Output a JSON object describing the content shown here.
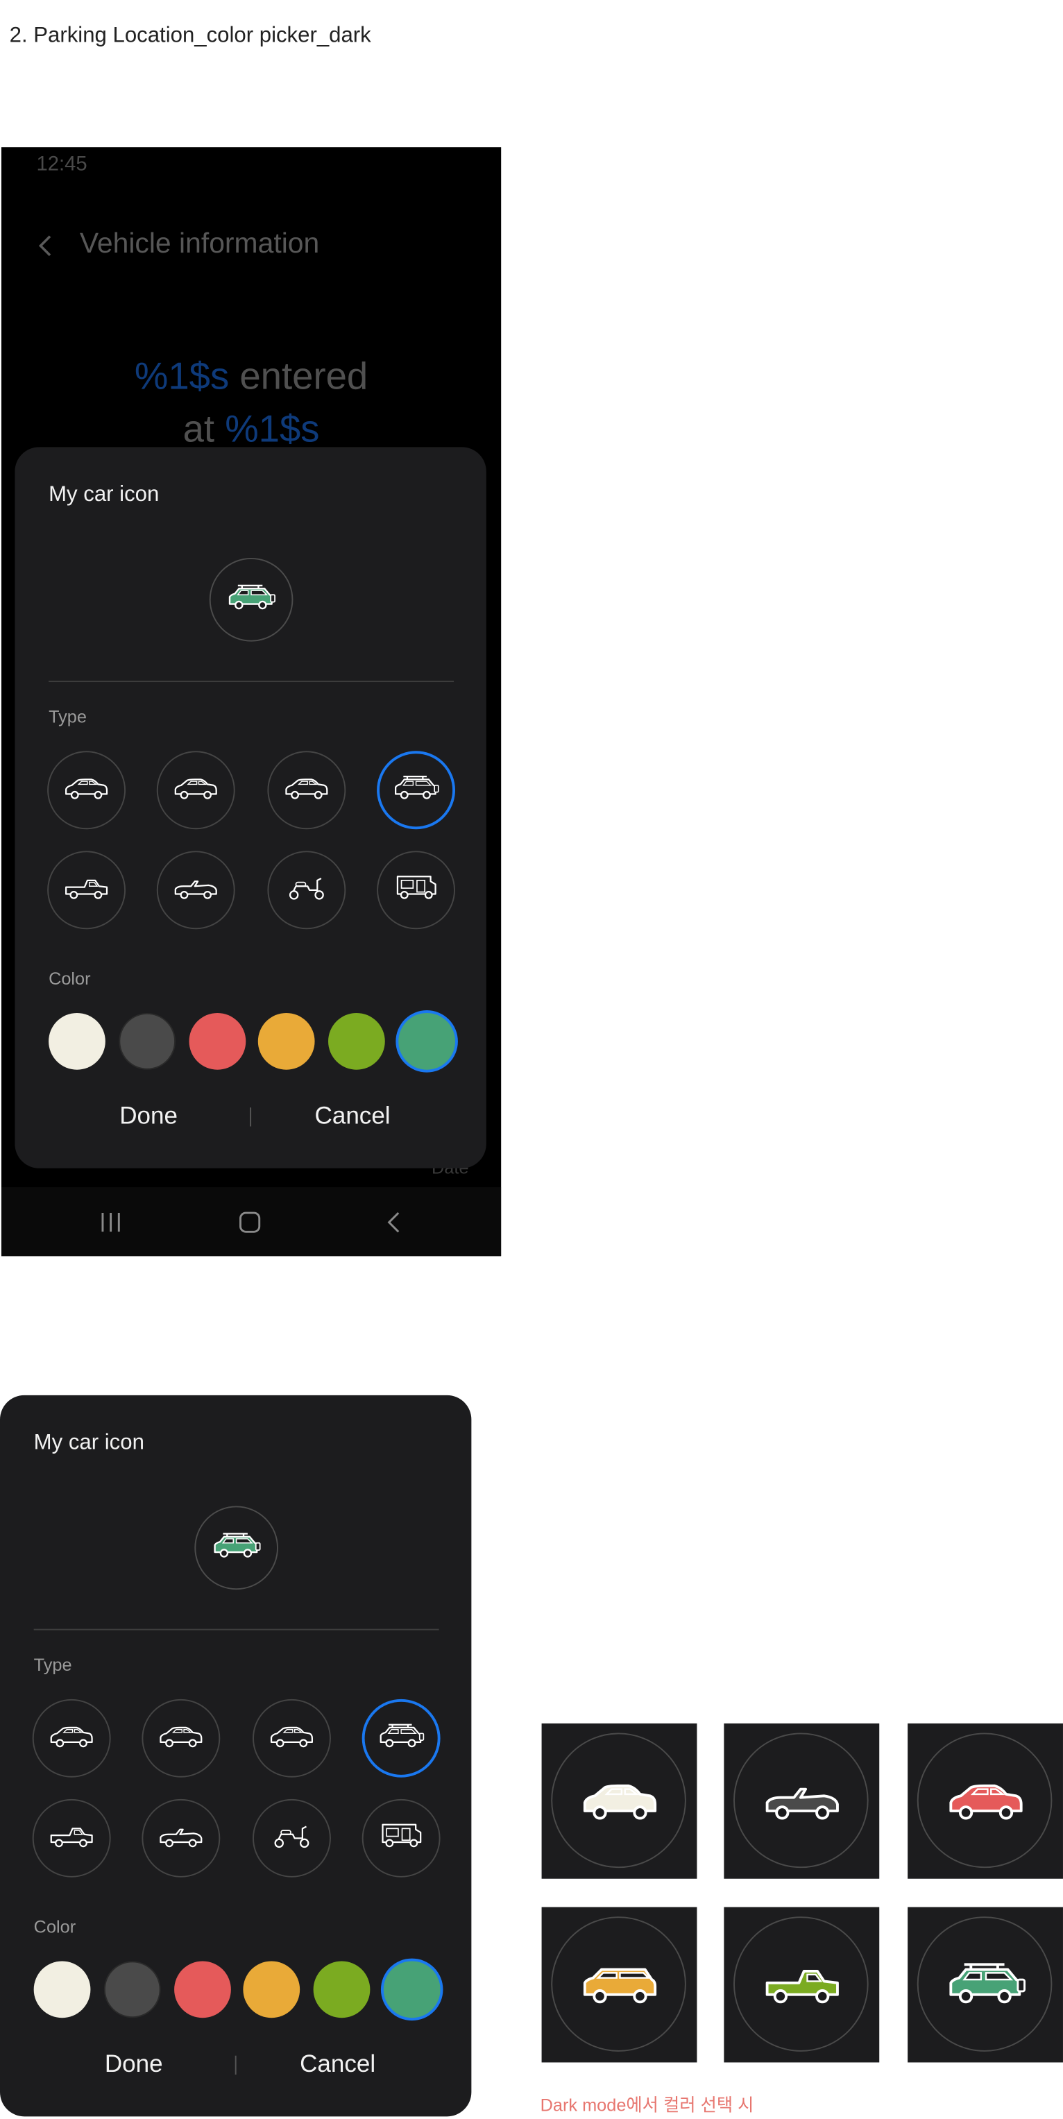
{
  "page_title": "2. Parking Location_color picker_dark",
  "phone": {
    "status_time": "12:45",
    "screen_title": "Vehicle information",
    "back_icon": "chevron-left-icon",
    "entered_line1_value": "%1$s",
    "entered_line1_text": " entered",
    "entered_line2_text": "at ",
    "entered_line2_value": "%1$s",
    "date_label": "Date",
    "nav_icons": [
      "recents-icon",
      "home-icon",
      "back-icon"
    ]
  },
  "dialog": {
    "title": "My car icon",
    "type_label": "Type",
    "color_label": "Color",
    "done_label": "Done",
    "cancel_label": "Cancel",
    "preview_icon": "suv-roofrack-icon",
    "preview_color": "#47a276",
    "selected_type_index": 3,
    "types": [
      "sedan-icon",
      "sedan-icon",
      "sedan-icon",
      "suv-roofrack-icon",
      "pickup-truck-icon",
      "convertible-icon",
      "scooter-icon",
      "camper-van-icon"
    ],
    "colors": [
      "#f2efe2",
      "#4a4a4a",
      "#e55a5a",
      "#e9aa38",
      "#7bab21",
      "#47a276"
    ],
    "selected_color_index": 5,
    "selection_color": "#1a78f0"
  },
  "color_samples": [
    {
      "icon": "sedan-icon",
      "color": "#f2efe2"
    },
    {
      "icon": "convertible-icon",
      "color": "#4a4a4a"
    },
    {
      "icon": "sedan-icon",
      "color": "#e55a5a"
    },
    {
      "icon": "wagon-icon",
      "color": "#e9aa38"
    },
    {
      "icon": "pickup-truck-icon",
      "color": "#7bab21"
    },
    {
      "icon": "suv-roofrack-icon",
      "color": "#47a276"
    }
  ],
  "caption": "Dark mode에서 컬러 선택 시"
}
